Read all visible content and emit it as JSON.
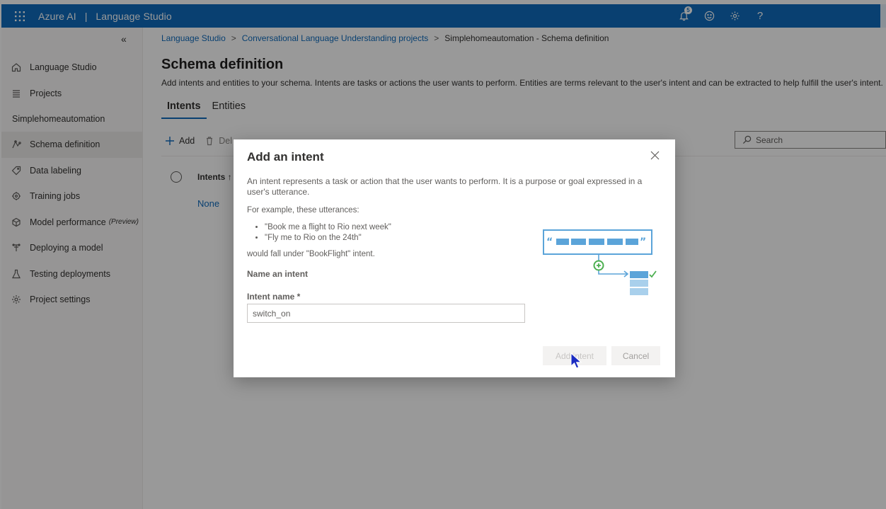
{
  "topbar": {
    "brand_left": "Azure AI",
    "separator": "|",
    "brand_right": "Language Studio",
    "notification_count": "5",
    "help_glyph": "?"
  },
  "sidebar": {
    "collapse_glyph": "«",
    "items": [
      {
        "label": "Language Studio",
        "icon": "home-icon"
      },
      {
        "label": "Projects",
        "icon": "list-icon"
      }
    ],
    "project_name": "Simplehomeautomation",
    "project_items": [
      {
        "label": "Schema definition",
        "icon": "schema-icon",
        "active": true
      },
      {
        "label": "Data labeling",
        "icon": "tag-icon"
      },
      {
        "label": "Training jobs",
        "icon": "training-icon"
      },
      {
        "label": "Model performance",
        "suffix": "(Preview)",
        "icon": "model-icon"
      },
      {
        "label": "Deploying a model",
        "icon": "deploy-icon"
      },
      {
        "label": "Testing deployments",
        "icon": "flask-icon"
      },
      {
        "label": "Project settings",
        "icon": "gear-icon"
      }
    ]
  },
  "main": {
    "breadcrumb": {
      "item1": "Language Studio",
      "item2": "Conversational Language Understanding projects",
      "item3": "Simplehomeautomation - Schema definition",
      "sep": ">"
    },
    "title": "Schema definition",
    "description": "Add intents and entities to your schema. Intents are tasks or actions the user wants to perform. Entities are terms relevant to the user's intent and can be extracted to help fulfill the user's intent.",
    "tabs": [
      "Intents",
      "Entities"
    ],
    "toolbar": {
      "add": "Add",
      "delete": "Del"
    },
    "search_placeholder": "Search",
    "table": {
      "header": "Intents ↑",
      "row": "None"
    }
  },
  "dialog": {
    "title": "Add an intent",
    "description": "An intent represents a task or action that the user wants to perform. It is a purpose or goal expressed in a user's utterance.",
    "example_intro": "For example, these utterances:",
    "examples": [
      "\"Book me a flight to Rio next week\"",
      "\"Fly me to Rio on the 24th\""
    ],
    "fall_under": "would fall under \"BookFlight\" intent.",
    "section_label": "Name an intent",
    "field_label": "Intent name *",
    "field_value": "switch_on",
    "add_button": "Add intent",
    "cancel_button": "Cancel"
  },
  "colors": {
    "accent": "#0f6cbd",
    "illustration": "#5ba4d9"
  }
}
